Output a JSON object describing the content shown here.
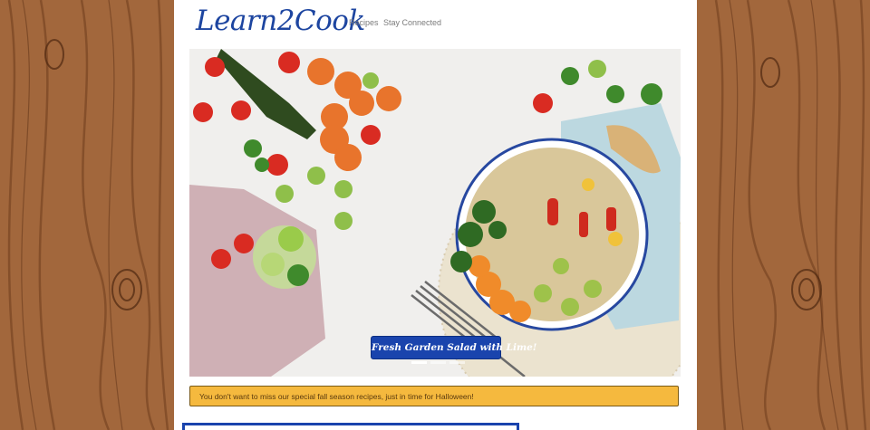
{
  "brand": {
    "name": "Learn2Cook"
  },
  "nav": {
    "items": [
      {
        "label": "Recipes"
      },
      {
        "label": "Stay Connected"
      }
    ]
  },
  "carousel": {
    "caption": "Fresh Garden Salad with Lime!",
    "slide_count": 3,
    "active_slide": 1
  },
  "alert": {
    "text": "You don't want to miss our special fall season recipes, just in time for Halloween!"
  },
  "colors": {
    "brand_blue": "#1d45a0",
    "alert_bg": "#f5b93e",
    "wood": "#a0643a"
  }
}
